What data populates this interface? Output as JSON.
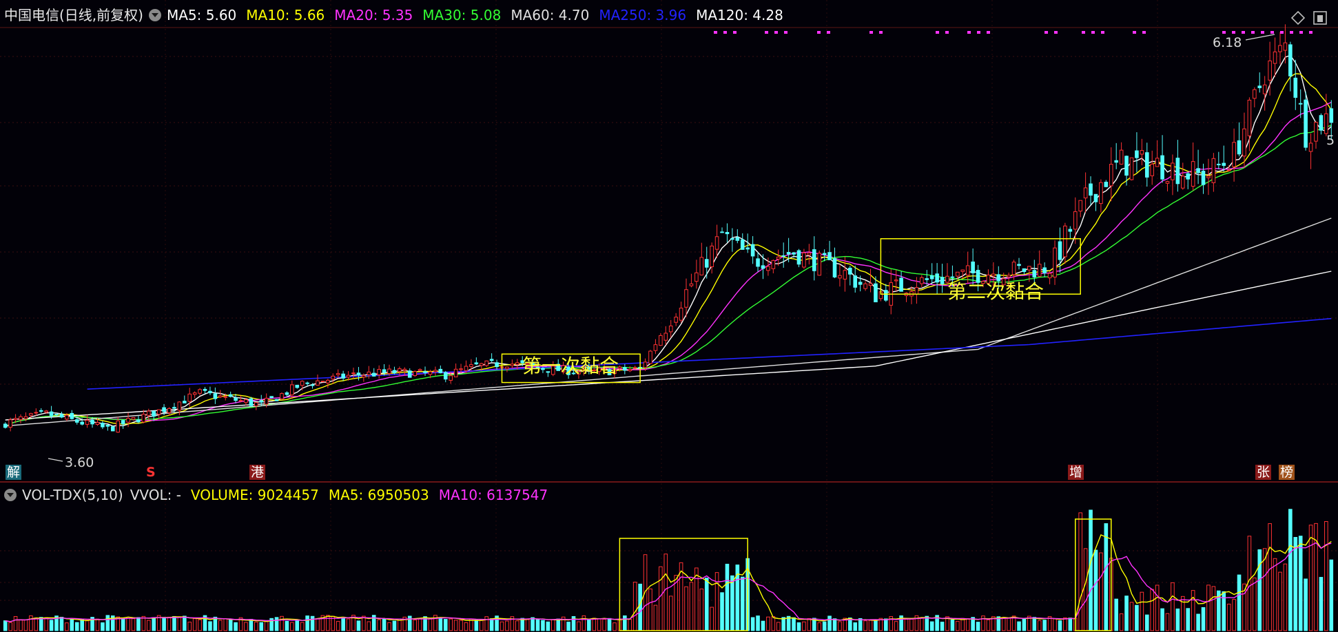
{
  "header": {
    "title": "中国电信(日线,前复权)",
    "ma": [
      {
        "label": "MA5:",
        "value": "5.60",
        "color": "#ffffff"
      },
      {
        "label": "MA10:",
        "value": "5.66",
        "color": "#ffff00"
      },
      {
        "label": "MA20:",
        "value": "5.35",
        "color": "#ff33ff"
      },
      {
        "label": "MA30:",
        "value": "5.08",
        "color": "#33ff33"
      },
      {
        "label": "MA60:",
        "value": "4.70",
        "color": "#e0e0e0"
      },
      {
        "label": "MA250:",
        "value": "3.96",
        "color": "#2222ff"
      },
      {
        "label": "MA120:",
        "value": "4.28",
        "color": "#ffffff"
      }
    ]
  },
  "vol_header": {
    "title": "VOL-TDX(5,10)",
    "vvol": "VVOL: -",
    "volume": "VOLUME: 9024457",
    "ma5": "MA5: 6950503",
    "ma10": "MA10: 6137547",
    "colors": {
      "title": "#e0e0e0",
      "volume": "#ffff00",
      "ma5": "#ffff00",
      "ma10": "#ff33ff"
    }
  },
  "markers": {
    "high": "6.18",
    "low": "3.60",
    "right_edge": "5",
    "tags": [
      "解",
      "S",
      "港",
      "增",
      "张",
      "榜"
    ]
  },
  "annotations": {
    "first": "第一次黏合",
    "second": "第二次黏合"
  },
  "icons": [
    "diamond-icon",
    "window-icon",
    "dropdown-icon"
  ],
  "chart_data": {
    "type": "candlestick",
    "candles_count": 260,
    "ylim_price": [
      3.6,
      6.18
    ],
    "series": [
      {
        "name": "MA5",
        "color": "#ffffff"
      },
      {
        "name": "MA10",
        "color": "#ffff00"
      },
      {
        "name": "MA20",
        "color": "#ff33ff"
      },
      {
        "name": "MA30",
        "color": "#33ff33"
      },
      {
        "name": "MA60",
        "color": "#e0e0e0"
      },
      {
        "name": "MA120",
        "color": "#ffffff"
      },
      {
        "name": "MA250",
        "color": "#2222ff"
      }
    ],
    "colors": {
      "up": "#ff3232",
      "down": "#54ffff",
      "box": "#ffff00"
    }
  }
}
